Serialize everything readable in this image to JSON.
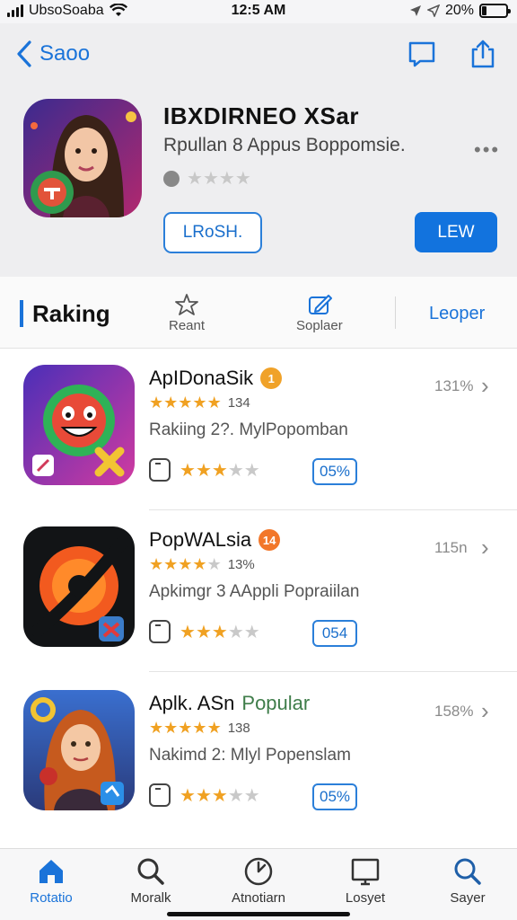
{
  "status_bar": {
    "carrier": "UbsoSoaba",
    "time": "12:5 AM",
    "battery": "20%",
    "battery_level": 0.2
  },
  "header": {
    "back_label": "Saoo",
    "icons": [
      "chat-icon",
      "share-icon"
    ]
  },
  "app": {
    "title": "IBXDIRNEO XSar",
    "subtitle": "Rpullan 8 Appus Boppomsie.",
    "more": "•••",
    "rating_stars": 4,
    "secondary_button": "LRoSH.",
    "primary_button": "LEW"
  },
  "ranking": {
    "title": "Raking",
    "tabs": [
      {
        "label": "Reant",
        "icon": "star-badge-icon"
      },
      {
        "label": "Soplaer",
        "icon": "edit-icon"
      }
    ],
    "link": "Leoper"
  },
  "apps": [
    {
      "name": "ApIDonaSik",
      "accent": "",
      "badge": "1",
      "stars": 5,
      "reviews": "134",
      "description": "Rakiing 2?. MylPopomban",
      "mini_stars": 3,
      "percent": "05%",
      "meta": "131%"
    },
    {
      "name": "PopWALsia",
      "accent": "",
      "badge": "14",
      "stars": 4,
      "reviews": "13%",
      "description": "Apkimgr 3 AAppli Popraiilan",
      "mini_stars": 3,
      "percent": "054",
      "meta": "115n"
    },
    {
      "name": "Aplk. ASn",
      "accent": "Popular",
      "badge": "",
      "stars": 5,
      "reviews": "138",
      "description": "Nakimd 2: Mlyl Popenslam",
      "mini_stars": 3,
      "percent": "05%",
      "meta": "158%"
    }
  ],
  "tab_bar": [
    {
      "label": "Rotatio",
      "icon": "home-icon",
      "active": true
    },
    {
      "label": "Moralk",
      "icon": "search-icon",
      "active": false
    },
    {
      "label": "Atnotiarn",
      "icon": "compass-icon",
      "active": false
    },
    {
      "label": "Losyet",
      "icon": "monitor-icon",
      "active": false
    },
    {
      "label": "Sayer",
      "icon": "search-icon",
      "active": false
    }
  ],
  "colors": {
    "accent": "#1a73d9",
    "star": "#f0a122",
    "primary_button": "#1273de"
  }
}
